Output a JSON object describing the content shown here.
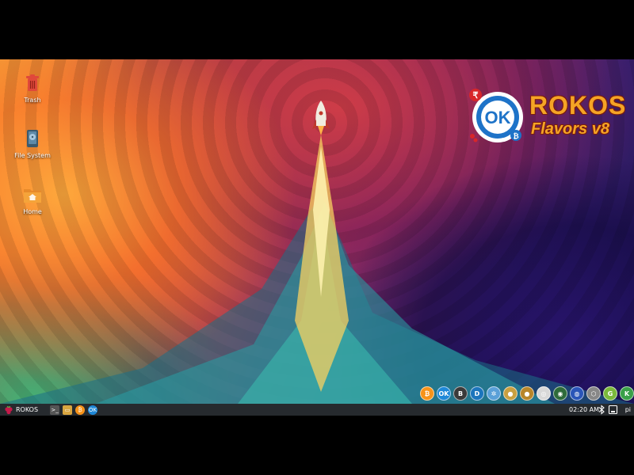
{
  "desktop": {
    "icons": [
      {
        "label": "Trash",
        "icon": "trash-icon"
      },
      {
        "label": "File System",
        "icon": "hard-drive-icon"
      },
      {
        "label": "Home",
        "icon": "home-folder-icon"
      }
    ]
  },
  "logo": {
    "title": "ROKOS",
    "subtitle": "Flavors v8",
    "badge_text": "OK"
  },
  "coin_tray": [
    {
      "name": "bitcoin",
      "glyph": "₿",
      "color": "#f7931a"
    },
    {
      "name": "okcash",
      "glyph": "OK",
      "color": "#1e88d8"
    },
    {
      "name": "bitcoin-dark",
      "glyph": "B",
      "color": "#3a3a3a"
    },
    {
      "name": "dash",
      "glyph": "D",
      "color": "#1c75bc"
    },
    {
      "name": "gear-coin",
      "glyph": "✲",
      "color": "#5aa0d8"
    },
    {
      "name": "gold-coin",
      "glyph": "●",
      "color": "#c9a040"
    },
    {
      "name": "bronze-coin",
      "glyph": "●",
      "color": "#b8862a"
    },
    {
      "name": "scan-coin",
      "glyph": "◎",
      "color": "#d8d8d8"
    },
    {
      "name": "green-eye-coin",
      "glyph": "◉",
      "color": "#2e6b3a"
    },
    {
      "name": "blue-coin",
      "glyph": "◍",
      "color": "#2a55b8"
    },
    {
      "name": "hex-coin",
      "glyph": "⬡",
      "color": "#888888"
    },
    {
      "name": "gcoin",
      "glyph": "G",
      "color": "#7ab93b"
    },
    {
      "name": "kcoin",
      "glyph": "K",
      "color": "#3aa048"
    },
    {
      "name": "tree-coin",
      "glyph": "♣",
      "color": "#b03030"
    },
    {
      "name": "yellow-coin",
      "glyph": "A",
      "color": "#e9b90d"
    },
    {
      "name": "leaf-coin",
      "glyph": "V",
      "color": "#7fb241"
    },
    {
      "name": "network-coin",
      "glyph": "✺",
      "color": "#1a5a8a"
    }
  ],
  "taskbar": {
    "start_label": "ROKOS",
    "launchers": [
      {
        "name": "terminal",
        "glyph": ">_",
        "color": "#555555"
      },
      {
        "name": "file-manager",
        "glyph": "▭",
        "color": "#d9a640"
      },
      {
        "name": "bitcoin",
        "glyph": "₿",
        "color": "#f7931a"
      },
      {
        "name": "okcash",
        "glyph": "OK",
        "color": "#1e88d8"
      }
    ],
    "clock": "02:20 AM",
    "user": "pi"
  }
}
